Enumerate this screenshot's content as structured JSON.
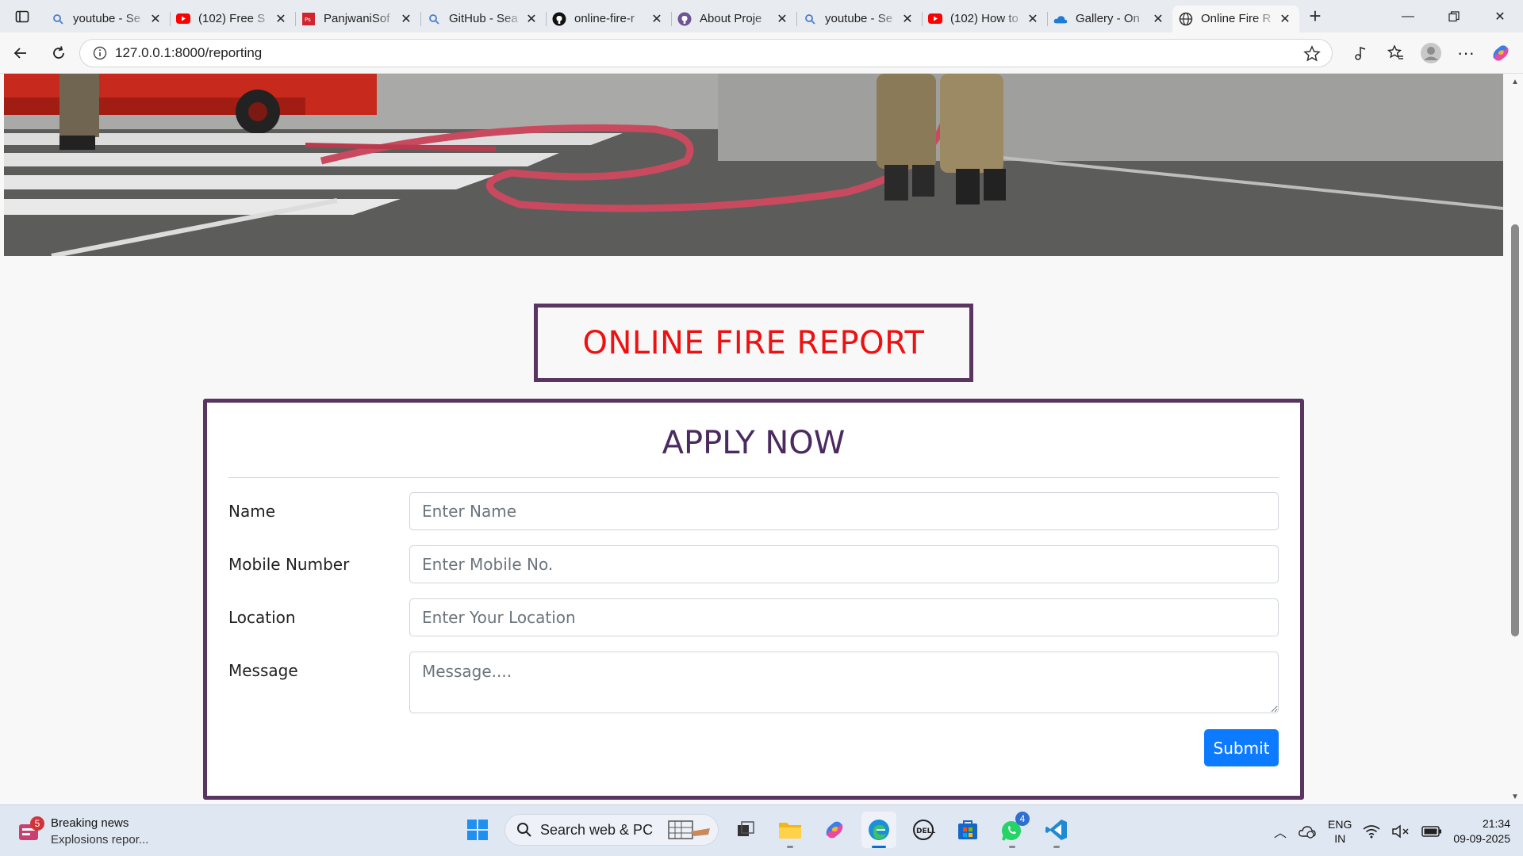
{
  "browser": {
    "tabs": [
      {
        "title": "youtube - Se",
        "icon": "search-icon",
        "color": "#4a7bd0"
      },
      {
        "title": "(102) Free S",
        "icon": "youtube-icon",
        "color": "#ff0000"
      },
      {
        "title": "PanjwaniSof",
        "icon": "ps-icon",
        "color": "#d1242f"
      },
      {
        "title": "GitHub - Sea",
        "icon": "search-icon",
        "color": "#4a7bd0"
      },
      {
        "title": "online-fire-r",
        "icon": "github-icon",
        "color": "#111111"
      },
      {
        "title": "About Proje",
        "icon": "github-icon",
        "color": "#6e5494"
      },
      {
        "title": "youtube - Se",
        "icon": "search-icon",
        "color": "#4a7bd0"
      },
      {
        "title": "(102) How to",
        "icon": "youtube-icon",
        "color": "#ff0000"
      },
      {
        "title": "Gallery - On",
        "icon": "onedrive-icon",
        "color": "#1e7bd6"
      },
      {
        "title": "Online Fire R",
        "icon": "globe-icon",
        "color": "#333333",
        "active": true
      }
    ],
    "url": "127.0.0.1:8000/reporting"
  },
  "page": {
    "title": "ONLINE FIRE REPORT",
    "form_heading": "APPLY NOW",
    "fields": [
      {
        "label": "Name",
        "placeholder": "Enter Name"
      },
      {
        "label": "Mobile Number",
        "placeholder": "Enter Mobile No."
      },
      {
        "label": "Location",
        "placeholder": "Enter Your Location"
      },
      {
        "label": "Message",
        "placeholder": "Message...."
      }
    ],
    "submit_label": "Submit",
    "accent_color": "#5a3561",
    "title_color": "#ee1111",
    "button_color": "#0d7bff"
  },
  "taskbar": {
    "news_badge": "5",
    "news_title": "Breaking news",
    "news_subtitle": "Explosions repor...",
    "search_label": "Search web & PC",
    "whatsapp_badge": "4",
    "lang_line1": "ENG",
    "lang_line2": "IN",
    "time": "21:34",
    "date": "09-09-2025"
  }
}
